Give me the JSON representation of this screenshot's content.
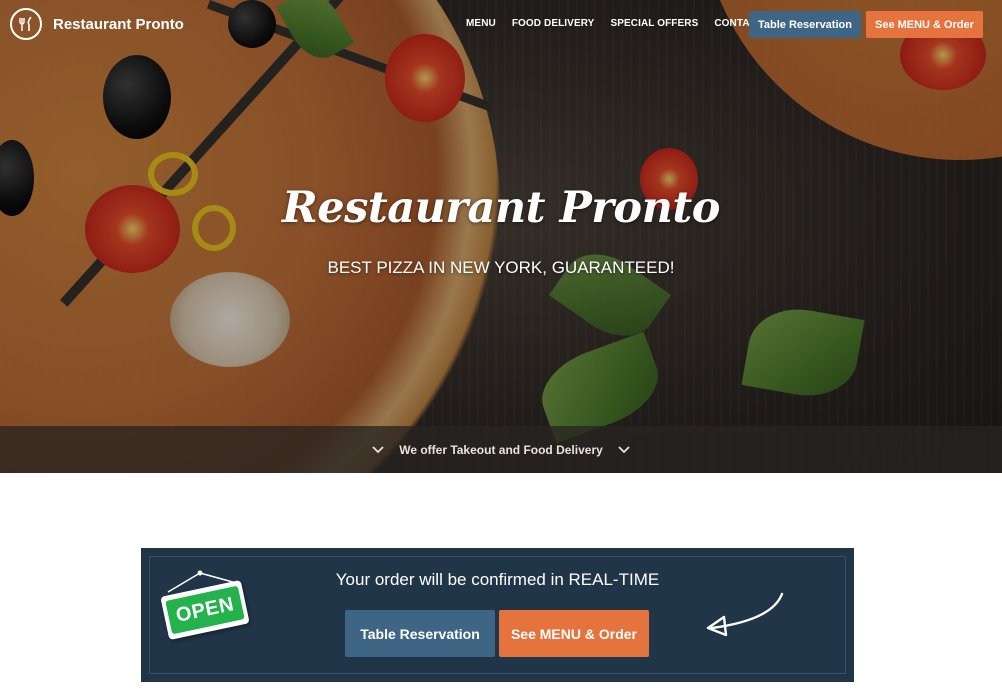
{
  "brand": {
    "name": "Restaurant Pronto"
  },
  "nav": {
    "items": [
      "MENU",
      "FOOD DELIVERY",
      "SPECIAL OFFERS",
      "CONTACT US"
    ],
    "reservation_label": "Table Reservation",
    "menu_order_label": "See MENU & Order"
  },
  "hero": {
    "title": "Restaurant Pronto",
    "subtitle": "BEST PIZZA IN NEW YORK, GUARANTEED!",
    "bar_text": "We offer Takeout and Food Delivery"
  },
  "cta": {
    "message": "Your order will be confirmed in REAL-TIME",
    "open_sign": "OPEN",
    "reservation_label": "Table Reservation",
    "menu_order_label": "See MENU & Order"
  },
  "colors": {
    "accent_blue": "#3f6585",
    "accent_orange": "#e5733e",
    "cta_background": "#213549",
    "open_green": "#23b24b"
  },
  "icons": [
    "restaurant-logo-icon",
    "chevron-down-icon",
    "arrow-icon"
  ]
}
